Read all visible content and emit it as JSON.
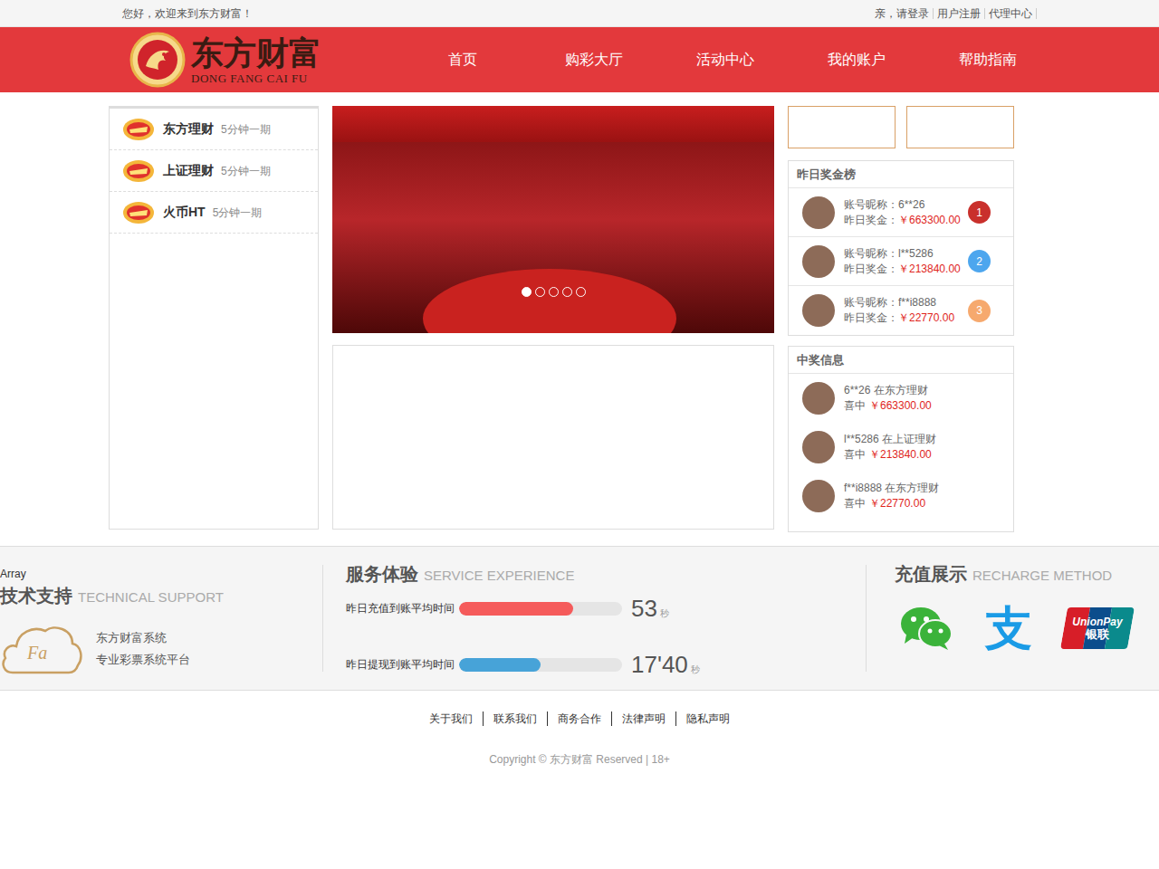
{
  "top_bar": {
    "welcome": "您好，欢迎来到东方财富！",
    "links": [
      "亲，请登录",
      "用户注册",
      "代理中心"
    ]
  },
  "logo": {
    "name": "东方财富",
    "pinyin": "DONG FANG CAI FU"
  },
  "nav": [
    {
      "label": "首页",
      "selected": false
    },
    {
      "label": "购彩大厅",
      "selected": false
    },
    {
      "label": "活动中心",
      "selected": false
    },
    {
      "label": "我的账户",
      "selected": false
    },
    {
      "label": "帮助指南",
      "selected": false
    }
  ],
  "lottery_list": [
    {
      "name": "东方理财",
      "period": "5分钟一期"
    },
    {
      "name": "上证理财",
      "period": "5分钟一期"
    },
    {
      "name": "火币HT",
      "period": "5分钟一期"
    }
  ],
  "banner": {
    "dots": [
      {
        "selected": true
      },
      {
        "selected": false
      },
      {
        "selected": false
      },
      {
        "selected": false
      },
      {
        "selected": false
      }
    ]
  },
  "leaderboard": {
    "title": "昨日奖金榜",
    "rows": [
      {
        "nick_label": "账号昵称：",
        "nick": "6**26",
        "bonus_label": "昨日奖金：",
        "bonus": "￥663300.00",
        "rank": "1",
        "color": "#c9302c"
      },
      {
        "nick_label": "账号昵称：",
        "nick": "l**5286",
        "bonus_label": "昨日奖金：",
        "bonus": "￥213840.00",
        "rank": "2",
        "color": "#4da6ee"
      },
      {
        "nick_label": "账号昵称：",
        "nick": "f**i8888",
        "bonus_label": "昨日奖金：",
        "bonus": "￥22770.00",
        "rank": "3",
        "color": "#f6a96e"
      }
    ]
  },
  "wins": {
    "title": "中奖信息",
    "rows": [
      {
        "text": "6**26 在东方理财",
        "prefix": "喜中",
        "amount": "￥663300.00"
      },
      {
        "text": "l**5286 在上证理财",
        "prefix": "喜中",
        "amount": "￥213840.00"
      },
      {
        "text": "f**i8888 在东方理财",
        "prefix": "喜中",
        "amount": "￥22770.00"
      }
    ]
  },
  "info_band": {
    "debug": "Array",
    "support": {
      "title": "技术支持",
      "subtitle": "TECHNICAL SUPPORT",
      "logo_text": "Fa",
      "lines": [
        "东方财富系统",
        "专业彩票系统平台"
      ]
    },
    "service": {
      "title": "服务体验",
      "subtitle": "SERVICE EXPERIENCE",
      "metrics": [
        {
          "label": "昨日充值到账平均时间",
          "level": 0.7,
          "value": "53",
          "unit": "秒",
          "color": "#f55b5b"
        },
        {
          "label": "昨日提现到账平均时间",
          "level": 0.5,
          "value": "17'40",
          "unit": "秒",
          "color": "#47a3d8"
        }
      ]
    },
    "recharge": {
      "title": "充值展示",
      "subtitle": "RECHARGE METHOD",
      "methods": [
        {
          "kind": "wechat"
        },
        {
          "kind": "alipay",
          "glyph": "支"
        },
        {
          "kind": "unionpay",
          "text": "UnionPay",
          "text_cn": "银联"
        }
      ]
    }
  },
  "footer": {
    "links": [
      "关于我们",
      "联系我们",
      "商务合作",
      "法律声明",
      "隐私声明"
    ],
    "copyright": "Copyright © 东方财富 Reserved | 18+"
  }
}
